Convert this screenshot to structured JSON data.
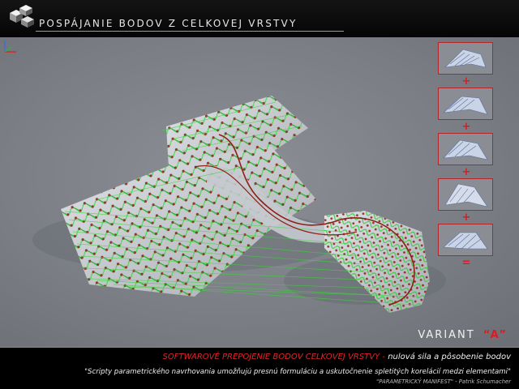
{
  "header": {
    "title": "POSPÁJANIE BODOV Z CELKOVEJ VRSTVY",
    "logo_icon": "checkered-cubes-logo"
  },
  "sidebar": {
    "operators": [
      "+",
      "+",
      "+",
      "+",
      "="
    ],
    "thumbnail_icon": "surface-preview-thumbnail"
  },
  "viewport": {
    "background_color": "#7e8288",
    "surface_color": "#c9cdd2",
    "connection_color": "#39d639",
    "point_color": "#a8231c",
    "axis_icon": "xyz-axis-gizmo"
  },
  "variant": {
    "label": "VARIANT",
    "value": "“A”"
  },
  "footer": {
    "line1_red": "SOFTWAROVÉ PREPOJENIE BODOV CELKOVEJ VRSTVY -",
    "line1_white": "nulová sila a pôsobenie bodov",
    "quote": "\"Scripty parametrického navrhovania umožňujú presnú formuláciu a uskutočnenie spletitých korelácií medzi elementami\"",
    "citation": "\"PARAMETRICKÝ MANIFEST\"  - Patrik Schumacher"
  },
  "colors": {
    "accent_red": "#d91c24",
    "header_bg": "#0b0b0b"
  }
}
